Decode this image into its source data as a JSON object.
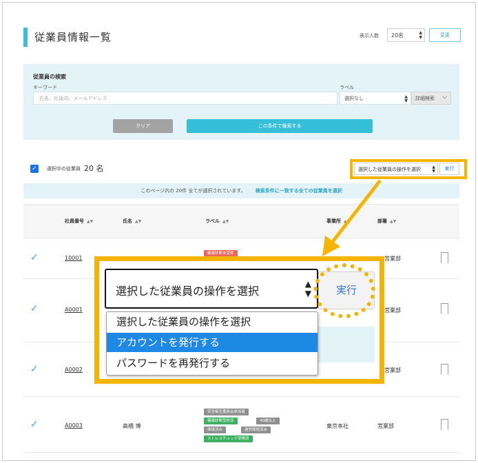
{
  "page": {
    "title": "従業員情報一覧"
  },
  "display": {
    "label": "表示人数",
    "value": "20名",
    "change_label": "変更"
  },
  "search": {
    "title": "従業員の検索",
    "keyword_label": "キーワード",
    "keyword_placeholder": "氏名、社員ID、メールアドレス",
    "label_label": "ラベル",
    "label_value": "選択なし",
    "detail_label": "詳細検索",
    "clear_label": "クリア",
    "apply_label": "この条件で検索する"
  },
  "selection": {
    "label": "選択中の従業員",
    "count": "20 名",
    "operation_placeholder": "選択した従業員の操作を選択",
    "execute_label": "実行",
    "notice": "このページ内の 20件 全てが選択されています。",
    "notice_link": "検索条件に一致する全ての従業員を選択"
  },
  "table": {
    "headers": [
      "社員番号",
      "氏名",
      "ラベル",
      "事業所",
      "部署"
    ],
    "rows": [
      {
        "id": "10001",
        "name": "",
        "office": "",
        "dept": "営業部",
        "tags": [
          "健康診断未受診"
        ]
      },
      {
        "id": "A0001",
        "name": "",
        "office": "",
        "dept": "営業部",
        "tags": []
      },
      {
        "id": "A0002",
        "name": "",
        "office": "",
        "dept": "営業部",
        "tags": []
      },
      {
        "id": "A0003",
        "name": "高橋 博",
        "office": "東京本社",
        "dept": "営業部",
        "tags": [
          "安全衛生委員会参加者",
          "健康診断受診済",
          "40歳以上",
          "面接済み",
          "過労面談済み",
          "ストレスチェック受検済"
        ]
      }
    ]
  },
  "zoom": {
    "select_value": "選択した従業員の操作を選択",
    "execute_label": "実行",
    "options": [
      "選択した従業員の操作を選択",
      "アカウントを発行する",
      "パスワードを再発行する"
    ],
    "selected_index": 1
  },
  "colors": {
    "accent": "#3bbfd7",
    "highlight": "#f4b400",
    "selected_option": "#1e88e5",
    "link": "#3b78c4"
  }
}
